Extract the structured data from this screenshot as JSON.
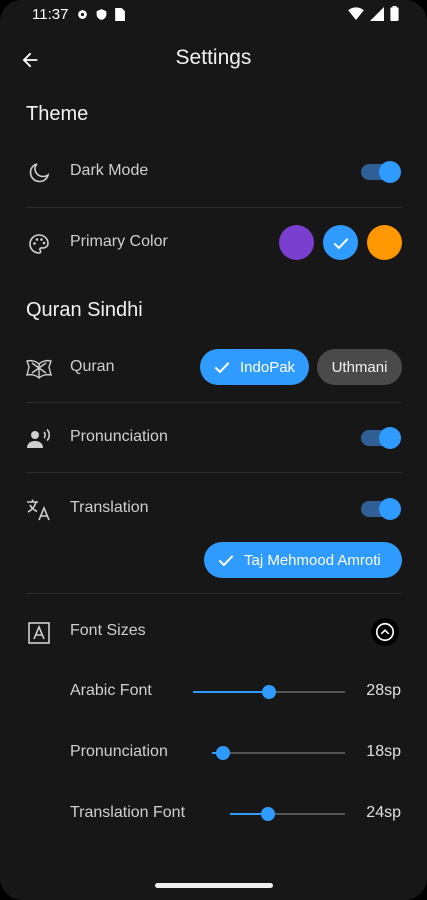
{
  "status": {
    "time": "11:37"
  },
  "appbar": {
    "title": "Settings"
  },
  "theme": {
    "title": "Theme",
    "dark_mode": {
      "label": "Dark Mode",
      "enabled": true
    },
    "primary_color": {
      "label": "Primary Color",
      "options": [
        "#7b3fd0",
        "#2f9bff",
        "#ff9800"
      ],
      "selected": 1
    }
  },
  "quran_sindhi": {
    "title": "Quran Sindhi",
    "quran": {
      "label": "Quran",
      "options": [
        "IndoPak",
        "Uthmani"
      ],
      "selected": "IndoPak"
    },
    "pronunciation": {
      "label": "Pronunciation",
      "enabled": true
    },
    "translation": {
      "label": "Translation",
      "enabled": true,
      "selected_translator": "Taj Mehmood Amroti"
    }
  },
  "font_sizes": {
    "label": "Font Sizes",
    "sliders": [
      {
        "label": "Arabic Font",
        "value": "28sp",
        "level": 0.5
      },
      {
        "label": "Pronunciation",
        "value": "18sp",
        "level": 0.08
      },
      {
        "label": "Translation Font",
        "value": "24sp",
        "level": 0.33
      }
    ]
  },
  "colors": {
    "accent": "#2f9bff",
    "background": "#171717"
  }
}
